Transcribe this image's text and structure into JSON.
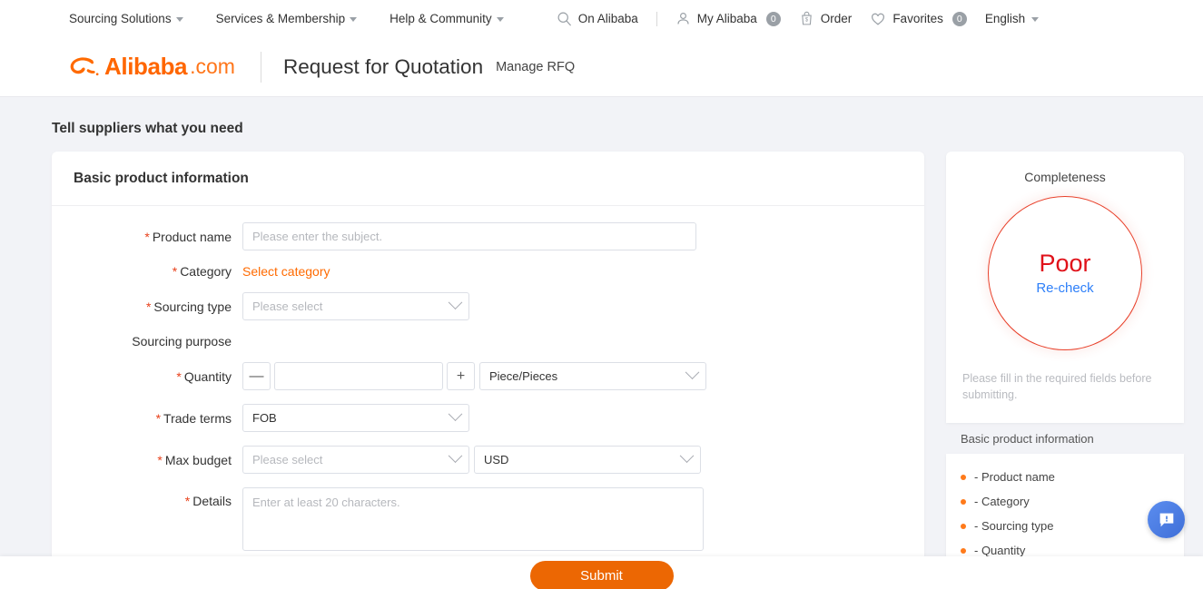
{
  "topnav": {
    "left": [
      {
        "label": "Sourcing Solutions",
        "icon": "chevron-down-icon"
      },
      {
        "label": "Services & Membership",
        "icon": "chevron-down-icon"
      },
      {
        "label": "Help & Community",
        "icon": "chevron-down-icon"
      }
    ],
    "search_label": "On Alibaba",
    "search_icon": "search-icon",
    "my_alibaba_label": "My Alibaba",
    "my_alibaba_icon": "user-icon",
    "my_alibaba_badge": "0",
    "order_label": "Order",
    "order_icon": "shopping-bag-icon",
    "favorites_label": "Favorites",
    "favorites_icon": "heart-icon",
    "favorites_badge": "0",
    "language_label": "English"
  },
  "brand": {
    "logo_word": "Alibaba",
    "logo_dotcom": ".com",
    "logo_icon": "alibaba-swirl-icon",
    "page_title": "Request for Quotation",
    "manage_link": "Manage RFQ"
  },
  "page": {
    "section_heading": "Tell suppliers what you need"
  },
  "form": {
    "card_title": "Basic product information",
    "product_name": {
      "label": "Product name",
      "required": "*",
      "placeholder": "Please enter the subject.",
      "value": ""
    },
    "category": {
      "label": "Category",
      "required": "*",
      "link": "Select category"
    },
    "sourcing_type": {
      "label": "Sourcing type",
      "required": "*",
      "value": "Please select"
    },
    "sourcing_purpose": {
      "label": "Sourcing purpose"
    },
    "quantity": {
      "label": "Quantity",
      "required": "*",
      "minus": "—",
      "plus": "+",
      "value": "",
      "unit": "Piece/Pieces"
    },
    "trade_terms": {
      "label": "Trade terms",
      "required": "*",
      "value": "FOB"
    },
    "max_budget": {
      "label": "Max budget",
      "required": "*",
      "value": "Please select",
      "currency": "USD"
    },
    "details": {
      "label": "Details",
      "required": "*",
      "placeholder": "Enter at least 20 characters.",
      "value": ""
    }
  },
  "completeness": {
    "title": "Completeness",
    "rating": "Poor",
    "recheck": "Re-check",
    "hint": "Please fill in the required fields before submitting.",
    "checklist_title": "Basic product information",
    "checklist": [
      "- Product name",
      "- Category",
      "- Sourcing type",
      "- Quantity"
    ]
  },
  "footer": {
    "submit_label": "Submit"
  },
  "fab": {
    "icon": "chat-bubble-alert-icon"
  },
  "colors": {
    "brand_orange": "#ff6a00",
    "submit_orange": "#ec6703",
    "required_red": "#e8401a",
    "poor_red": "#e0121a",
    "recheck_blue": "#2d7ff9",
    "page_bg": "#f2f3f7"
  }
}
